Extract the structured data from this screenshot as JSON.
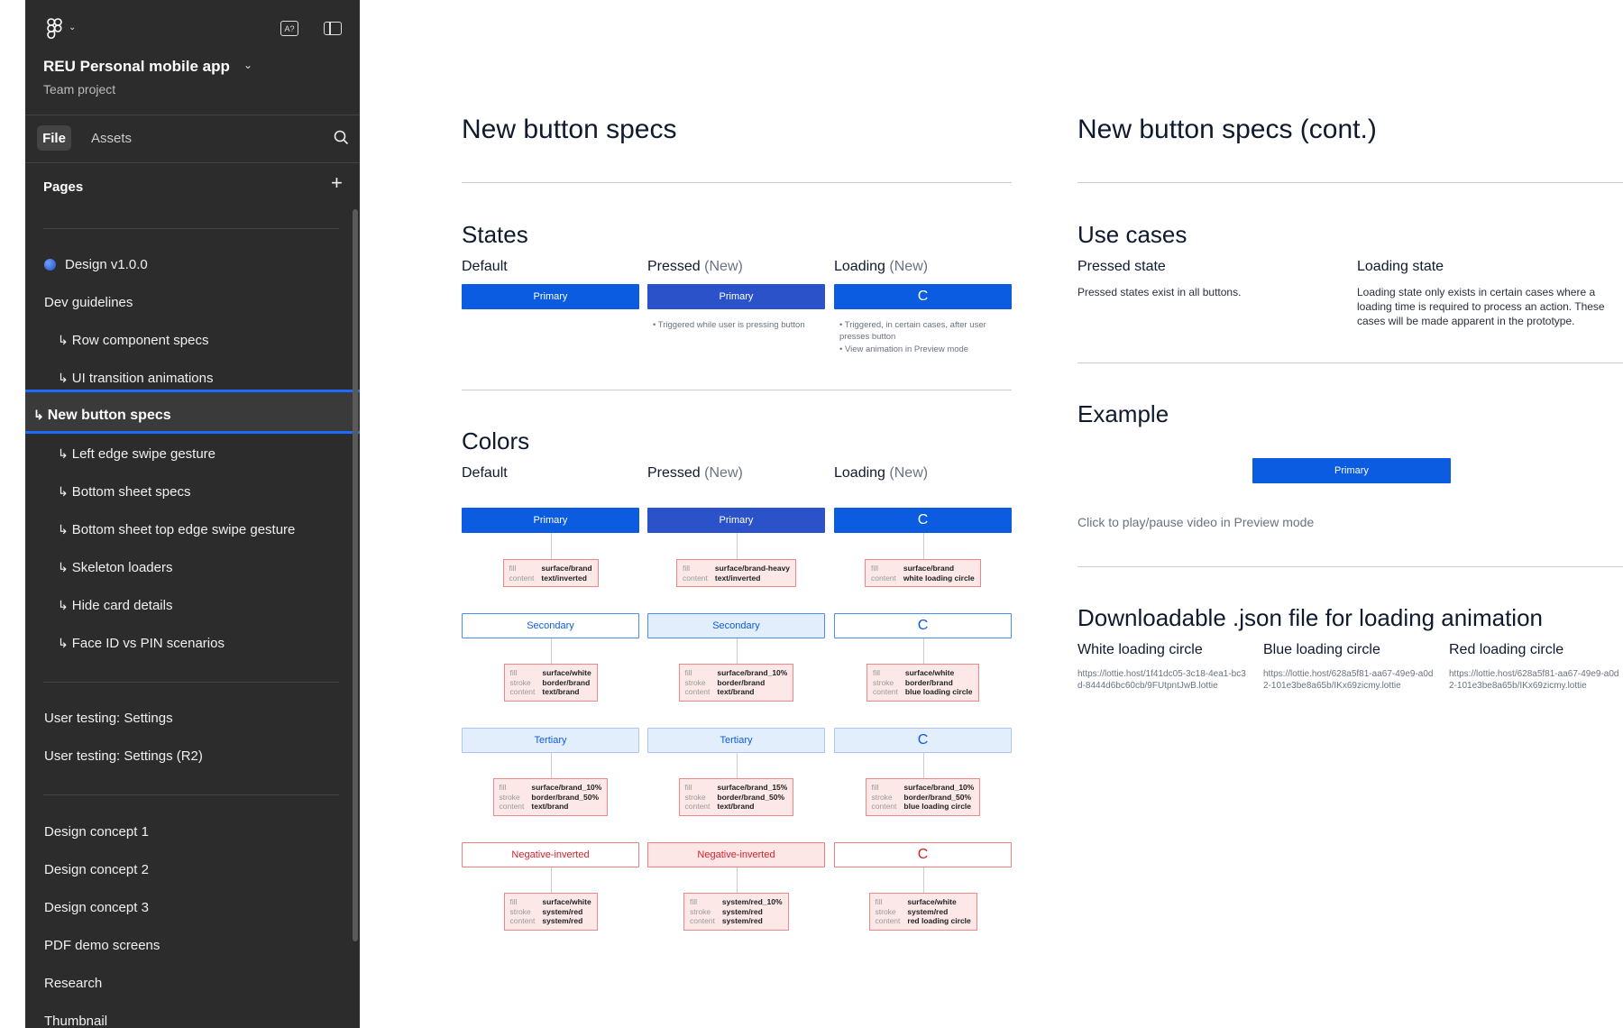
{
  "sidebar": {
    "project_name": "REU Personal mobile app",
    "project_sub": "Team project",
    "tabs": {
      "file": "File",
      "assets": "Assets"
    },
    "pages_label": "Pages",
    "pages": [
      {
        "label": "Design v1.0.0",
        "child": false,
        "dot": true
      },
      {
        "label": "Dev guidelines",
        "child": false
      },
      {
        "label": "Row component specs",
        "child": true
      },
      {
        "label": "UI transition animations",
        "child": true
      },
      {
        "label": "New button specs",
        "child": true,
        "selected": true
      },
      {
        "label": "Left edge swipe gesture",
        "child": true
      },
      {
        "label": "Bottom sheet specs",
        "child": true
      },
      {
        "label": "Bottom sheet top edge swipe gesture",
        "child": true
      },
      {
        "label": "Skeleton loaders",
        "child": true
      },
      {
        "label": "Hide card details",
        "child": true
      },
      {
        "label": "Face ID vs PIN scenarios",
        "child": true
      },
      {
        "label": "User testing: Settings",
        "child": false
      },
      {
        "label": "User testing: Settings (R2)",
        "child": false
      },
      {
        "label": "Design concept 1",
        "child": false
      },
      {
        "label": "Design concept 2",
        "child": false
      },
      {
        "label": "Design concept 3",
        "child": false
      },
      {
        "label": "PDF demo screens",
        "child": false
      },
      {
        "label": "Research",
        "child": false
      },
      {
        "label": "Thumbnail",
        "child": false
      }
    ]
  },
  "canvas": {
    "left": {
      "title": "New button specs",
      "states_title": "States",
      "colors_title": "Colors",
      "col_default": "Default",
      "col_pressed": "Pressed",
      "col_loading": "Loading",
      "new_tag": "(New)",
      "primary_label": "Primary",
      "pressed_note": "Triggered while user is pressing button",
      "loading_notes": [
        "Triggered, in certain cases, after user presses button",
        "View animation in Preview mode"
      ],
      "spinner": "C",
      "rows": [
        {
          "label": "Primary",
          "tokens": [
            {
              "keys": [
                "fill",
                "content"
              ],
              "vals": [
                "surface/brand",
                "text/inverted"
              ]
            },
            {
              "keys": [
                "fill",
                "content"
              ],
              "vals": [
                "surface/brand-heavy",
                "text/inverted"
              ]
            },
            {
              "keys": [
                "fill",
                "content"
              ],
              "vals": [
                "surface/brand",
                "white loading circle"
              ]
            }
          ]
        },
        {
          "label": "Secondary",
          "tokens": [
            {
              "keys": [
                "fill",
                "stroke",
                "content"
              ],
              "vals": [
                "surface/white",
                "border/brand",
                "text/brand"
              ]
            },
            {
              "keys": [
                "fill",
                "stroke",
                "content"
              ],
              "vals": [
                "surface/brand_10%",
                "border/brand",
                "text/brand"
              ]
            },
            {
              "keys": [
                "fill",
                "stroke",
                "content"
              ],
              "vals": [
                "surface/white",
                "border/brand",
                "blue loading circle"
              ]
            }
          ]
        },
        {
          "label": "Tertiary",
          "tokens": [
            {
              "keys": [
                "fill",
                "stroke",
                "content"
              ],
              "vals": [
                "surface/brand_10%",
                "border/brand_50%",
                "text/brand"
              ]
            },
            {
              "keys": [
                "fill",
                "stroke",
                "content"
              ],
              "vals": [
                "surface/brand_15%",
                "border/brand_50%",
                "text/brand"
              ]
            },
            {
              "keys": [
                "fill",
                "stroke",
                "content"
              ],
              "vals": [
                "surface/brand_10%",
                "border/brand_50%",
                "blue loading circle"
              ]
            }
          ]
        },
        {
          "label": "Negative-inverted",
          "tokens": [
            {
              "keys": [
                "fill",
                "stroke",
                "content"
              ],
              "vals": [
                "surface/white",
                "system/red",
                "system/red"
              ]
            },
            {
              "keys": [
                "fill",
                "stroke",
                "content"
              ],
              "vals": [
                "system/red_10%",
                "system/red",
                "system/red"
              ]
            },
            {
              "keys": [
                "fill",
                "stroke",
                "content"
              ],
              "vals": [
                "surface/white",
                "system/red",
                "red loading circle"
              ]
            }
          ]
        }
      ]
    },
    "right": {
      "title": "New button specs (cont.)",
      "use_cases_title": "Use cases",
      "pressed_state_title": "Pressed state",
      "pressed_state_body": "Pressed states exist in all buttons.",
      "loading_state_title": "Loading state",
      "loading_state_body": "Loading state only exists in certain cases where a loading time is required to process an action. These cases will be made apparent in the prototype.",
      "example_title": "Example",
      "example_button": "Primary",
      "example_caption": "Click to play/pause video in Preview mode",
      "download_title": "Downloadable .json file for loading animation",
      "downloads": [
        {
          "title": "White loading circle",
          "url": "https://lottie.host/1f41dc05-3c18-4ea1-bc3d-8444d6bc60cb/9FUtpntJwB.lottie"
        },
        {
          "title": "Blue loading circle",
          "url": "https://lottie.host/628a5f81-aa67-49e9-a0d2-101e3be8a65b/IKx69zicmy.lottie"
        },
        {
          "title": "Red loading circle",
          "url": "https://lottie.host/628a5f81-aa67-49e9-a0d2-101e3be8a65b/IKx69zicmy.lottie"
        }
      ]
    }
  }
}
